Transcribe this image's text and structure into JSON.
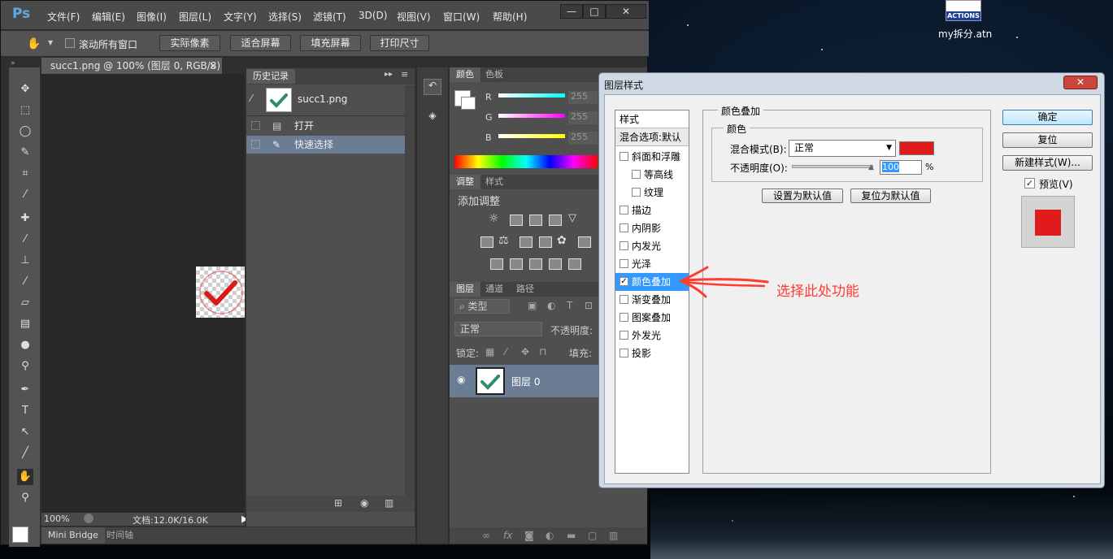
{
  "desktop": {
    "file_label": "my拆分.atn",
    "icon_text": "ACTIONS"
  },
  "annotation": {
    "text": "选择此处功能",
    "color": "#ff3b30"
  },
  "ps": {
    "logo": "Ps",
    "menu": [
      "文件(F)",
      "编辑(E)",
      "图像(I)",
      "图层(L)",
      "文字(Y)",
      "选择(S)",
      "滤镜(T)",
      "3D(D)",
      "视图(V)",
      "窗口(W)",
      "帮助(H)"
    ],
    "window_buttons": {
      "min": "—",
      "max": "□",
      "close": "✕"
    },
    "options": {
      "scroll_all": "滚动所有窗口",
      "actual_pixels": "实际像素",
      "fit_screen": "适合屏幕",
      "fill_screen": "填充屏幕",
      "print_size": "打印尺寸"
    },
    "doc_tab": {
      "title": "succ1.png @ 100% (图层 0, RGB/8)",
      "close": "×"
    },
    "status": {
      "zoom": "100%",
      "doc": "文档:12.0K/16.0K"
    },
    "bottom_tabs": [
      "Mini Bridge",
      "时间轴"
    ],
    "history": {
      "title": "历史记录",
      "snapshot": "succ1.png",
      "items": [
        "打开",
        "快速选择"
      ]
    },
    "color_panel": {
      "tabs": [
        "颜色",
        "色板"
      ],
      "channels": [
        {
          "name": "R",
          "value": "255",
          "color": "#00ffff"
        },
        {
          "name": "G",
          "value": "255",
          "color": "#ff00ff"
        },
        {
          "name": "B",
          "value": "255",
          "color": "#ffff00"
        }
      ]
    },
    "adjust_panel": {
      "tabs": [
        "调整",
        "样式"
      ],
      "heading": "添加调整"
    },
    "layers_panel": {
      "tabs": [
        "图层",
        "通道",
        "路径"
      ],
      "kind": "类型",
      "blend": "正常",
      "opacity_label": "不透明度:",
      "lock_label": "锁定:",
      "fill_label": "填充:",
      "layer_name": "图层 0"
    }
  },
  "dialog": {
    "title": "图层样式",
    "close": "✕",
    "styles_header": "样式",
    "blend_options": "混合选项:默认",
    "styles": [
      {
        "label": "斜面和浮雕",
        "checked": false,
        "indent": false
      },
      {
        "label": "等高线",
        "checked": false,
        "indent": true
      },
      {
        "label": "纹理",
        "checked": false,
        "indent": true
      },
      {
        "label": "描边",
        "checked": false,
        "indent": false
      },
      {
        "label": "内阴影",
        "checked": false,
        "indent": false
      },
      {
        "label": "内发光",
        "checked": false,
        "indent": false
      },
      {
        "label": "光泽",
        "checked": false,
        "indent": false
      },
      {
        "label": "颜色叠加",
        "checked": true,
        "indent": false,
        "selected": true
      },
      {
        "label": "渐变叠加",
        "checked": false,
        "indent": false
      },
      {
        "label": "图案叠加",
        "checked": false,
        "indent": false
      },
      {
        "label": "外发光",
        "checked": false,
        "indent": false
      },
      {
        "label": "投影",
        "checked": false,
        "indent": false
      }
    ],
    "group_title": "颜色叠加",
    "sub_title": "颜色",
    "blend_mode_label": "混合模式(B):",
    "blend_mode_value": "正常",
    "overlay_color": "#e11b1b",
    "opacity_label": "不透明度(O):",
    "opacity_value": "100",
    "opacity_unit": "%",
    "set_default": "设置为默认值",
    "reset_default": "复位为默认值",
    "ok": "确定",
    "reset": "复位",
    "new_style": "新建样式(W)...",
    "preview": "预览(V)"
  }
}
